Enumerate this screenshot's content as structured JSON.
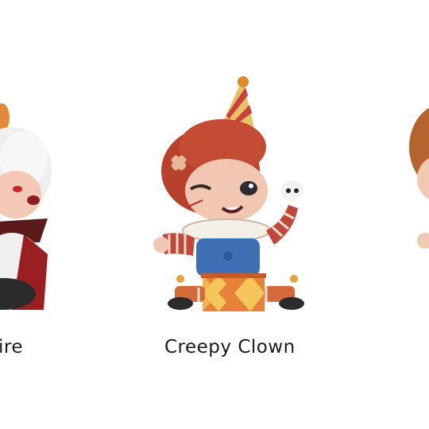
{
  "products": [
    {
      "name": "ire",
      "icon": "vampire-figure-icon"
    },
    {
      "name": "Creepy Clown",
      "icon": "creepy-clown-figure-icon"
    },
    {
      "name": "",
      "icon": "partial-figure-icon"
    }
  ],
  "colors": {
    "background": "#ffffff",
    "text": "#1a1a1a",
    "hair_red": "#b8412c",
    "hat_stripe": "#d9a441",
    "sleeve_stripe": "#c0473a",
    "shirt_blue": "#3f6fb5",
    "drum_orange": "#e8813a"
  }
}
